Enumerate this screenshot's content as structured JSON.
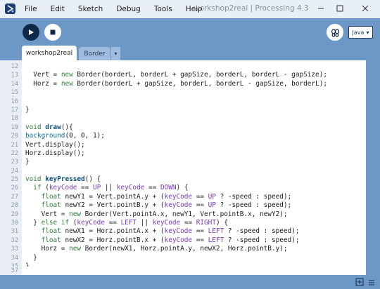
{
  "window": {
    "title": "workshop2real | Processing 4.3"
  },
  "menu": {
    "items": [
      {
        "label": "File"
      },
      {
        "label": "Edit"
      },
      {
        "label": "Sketch"
      },
      {
        "label": "Debug"
      },
      {
        "label": "Tools"
      },
      {
        "label": "Help"
      }
    ]
  },
  "toolbar": {
    "mode_label": "Java",
    "mode_caret": "▾"
  },
  "tabs": {
    "active": "workshop2real",
    "second": "Border",
    "menu_caret": "▾"
  },
  "editor": {
    "lines": [
      {
        "n": "12",
        "text": ""
      },
      {
        "n": "13",
        "text": "  Vert = new Border(borderL, borderL + gapSize, borderL, borderL - gapSize);"
      },
      {
        "n": "14",
        "text": "  Horz = new Border(borderL + gapSize, borderL, borderL - gapSize, borderL);"
      },
      {
        "n": "15",
        "text": ""
      },
      {
        "n": "16",
        "text": ""
      },
      {
        "n": "17",
        "text": "}"
      },
      {
        "n": "18",
        "text": ""
      },
      {
        "n": "19",
        "text": "void draw(){"
      },
      {
        "n": "20",
        "text": "background(0, 0, 1);"
      },
      {
        "n": "21",
        "text": "Vert.display();"
      },
      {
        "n": "22",
        "text": "Horz.display();"
      },
      {
        "n": "23",
        "text": "}"
      },
      {
        "n": "24",
        "text": ""
      },
      {
        "n": "25",
        "text": "void keyPressed() {"
      },
      {
        "n": "26",
        "text": "  if (keyCode == UP || keyCode == DOWN) {"
      },
      {
        "n": "27",
        "text": "    float newY1 = Vert.pointA.y + (keyCode == UP ? -speed : speed);"
      },
      {
        "n": "28",
        "text": "    float newY2 = Vert.pointB.y + (keyCode == UP ? -speed : speed);"
      },
      {
        "n": "29",
        "text": "    Vert = new Border(Vert.pointA.x, newY1, Vert.pointB.x, newY2);"
      },
      {
        "n": "30",
        "text": "  } else if (keyCode == LEFT || keyCode == RIGHT) {"
      },
      {
        "n": "31",
        "text": "    float newX1 = Horz.pointA.x + (keyCode == LEFT ? -speed : speed);"
      },
      {
        "n": "32",
        "text": "    float newX2 = Horz.pointB.x + (keyCode == LEFT ? -speed : speed);"
      },
      {
        "n": "33",
        "text": "    Horz = new Border(newX1, Horz.pointA.y, newX2, Horz.pointB.y);"
      },
      {
        "n": "34",
        "text": "  }"
      },
      {
        "n": "35",
        "text": "}"
      },
      {
        "n": "36",
        "text": ""
      }
    ],
    "console_line_number": "37"
  },
  "colors": {
    "background": "#6c97c6",
    "play_button": "#0e2847",
    "keyword": "#2f7d3a",
    "function": "#0e6e9e",
    "constant": "#7a3ab4"
  }
}
